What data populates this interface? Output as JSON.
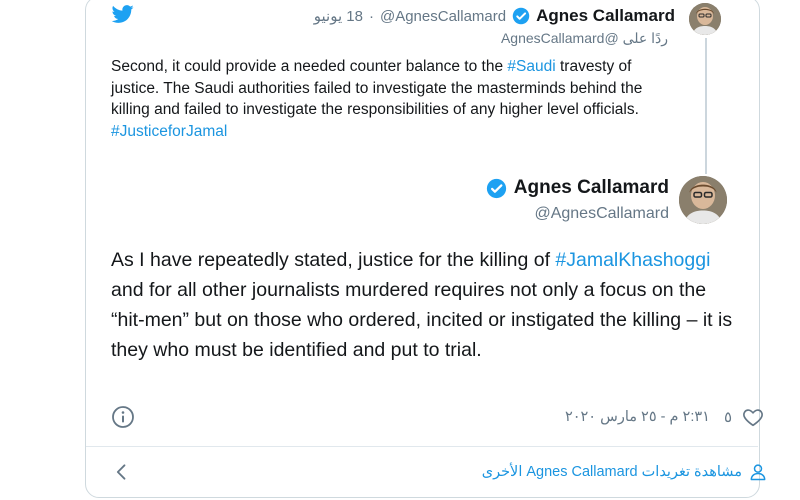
{
  "parent_tweet": {
    "name": "Agnes Callamard",
    "handle": "@AgnesCallamard",
    "separator": "·",
    "time": "18 يونيو",
    "reply_prefix": "ردًا على",
    "reply_to": "@AgnesCallamard",
    "text_1": "Second, it could provide a needed counter balance to the ",
    "hashtag_1": "#Saudi",
    "text_2": " travesty of justice. The Saudi authorities failed to investigate the masterminds behind the killing and failed to investigate the responsibilities of any higher level officials.  ",
    "hashtag_2": "#JusticeforJamal"
  },
  "main_tweet": {
    "name": "Agnes Callamard",
    "handle": "@AgnesCallamard",
    "text_1": "As I have repeatedly stated, justice for the killing of ",
    "hashtag": "#JamalKhashoggi",
    "text_2": " and for all other journalists murdered requires not only a focus on the “hit-men” but on those who ordered, incited or instigated the killing – it is they who must be identified and put to trial.",
    "like_count": "٥",
    "timestamp": "٢:٣١ م - ٢٥ مارس ٢٠٢٠"
  },
  "footer": {
    "view_more": "مشاهدة تغريدات Agnes Callamard الأخرى"
  },
  "icons": {
    "twitter": "twitter-bird-icon",
    "verified": "verified-badge-icon",
    "info": "info-icon",
    "like": "heart-icon",
    "profile": "person-icon",
    "back": "chevron-left-icon"
  },
  "colors": {
    "link": "#1b95e0",
    "muted": "#657786",
    "text": "#14171a",
    "twitter_blue": "#1da1f2"
  }
}
